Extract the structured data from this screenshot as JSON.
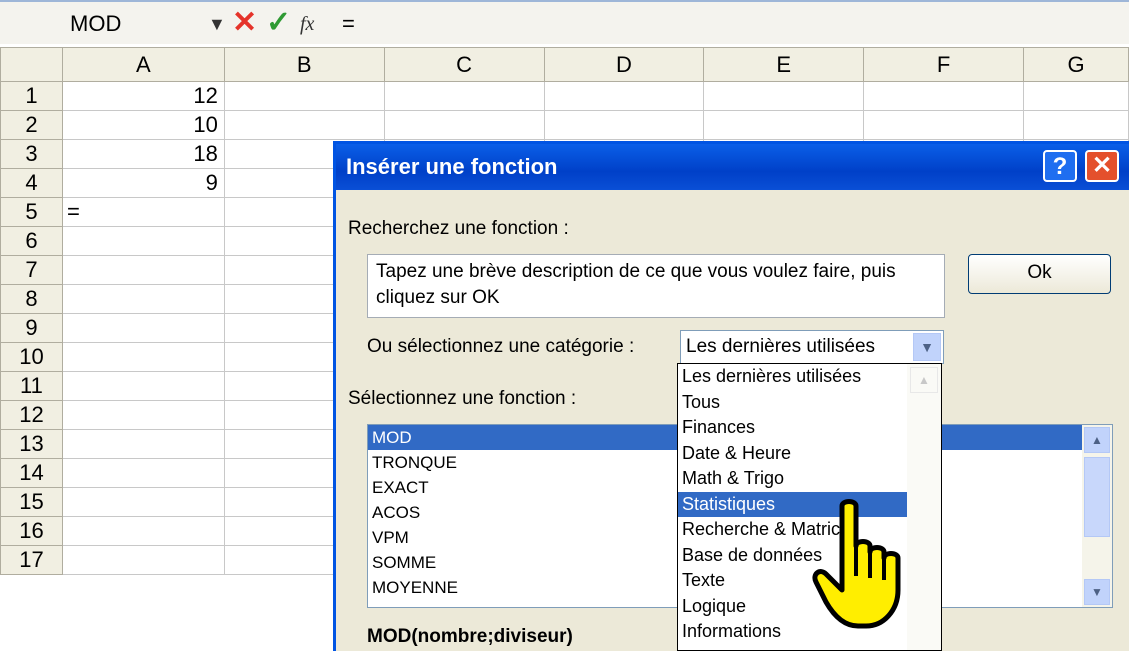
{
  "formula_bar": {
    "name_box": "MOD",
    "dropdown_glyph": "▼",
    "cancel_glyph": "✕",
    "enter_glyph": "✓",
    "fx_glyph": "fx",
    "formula": "="
  },
  "sheet": {
    "columns": [
      "A",
      "B",
      "C",
      "D",
      "E",
      "F",
      "G"
    ],
    "rows": [
      {
        "n": "1",
        "a": "12"
      },
      {
        "n": "2",
        "a": "10"
      },
      {
        "n": "3",
        "a": "18"
      },
      {
        "n": "4",
        "a": "9"
      },
      {
        "n": "5",
        "a": "="
      },
      {
        "n": "6",
        "a": ""
      },
      {
        "n": "7",
        "a": ""
      },
      {
        "n": "8",
        "a": ""
      },
      {
        "n": "9",
        "a": ""
      },
      {
        "n": "10",
        "a": ""
      },
      {
        "n": "11",
        "a": ""
      },
      {
        "n": "12",
        "a": ""
      },
      {
        "n": "13",
        "a": ""
      },
      {
        "n": "14",
        "a": ""
      },
      {
        "n": "15",
        "a": ""
      },
      {
        "n": "16",
        "a": ""
      },
      {
        "n": "17",
        "a": ""
      }
    ]
  },
  "dialog": {
    "title": "Insérer une fonction",
    "help": "?",
    "close": "✕",
    "search_label": "Recherchez une fonction :",
    "search_text": "Tapez une brève description de ce que vous voulez faire, puis cliquez sur OK",
    "ok_label": "Ok",
    "category_label": "Ou sélectionnez une catégorie :",
    "category_value": "Les dernières utilisées",
    "function_label": "Sélectionnez une fonction :",
    "functions": [
      "MOD",
      "TRONQUE",
      "EXACT",
      "ACOS",
      "VPM",
      "SOMME",
      "MOYENNE"
    ],
    "selected_function": "MOD",
    "signature": "MOD(nombre;diviseur)"
  },
  "category_dropdown": {
    "items": [
      "Les dernières utilisées",
      "Tous",
      "Finances",
      "Date & Heure",
      "Math & Trigo",
      "Statistiques",
      "Recherche & Matrices",
      "Base de données",
      "Texte",
      "Logique",
      "Informations"
    ],
    "highlighted": "Statistiques"
  },
  "icons": {
    "dropdown_arrow": "chevron-down-icon",
    "scroll_up": "chevron-up-icon",
    "cursor": "hand-pointer-icon"
  },
  "colors": {
    "title_bar": "#0054e3",
    "selection": "#316ac5",
    "cancel": "#e5332a",
    "enter": "#2f9a33",
    "cursor_fill": "#ffee00"
  }
}
